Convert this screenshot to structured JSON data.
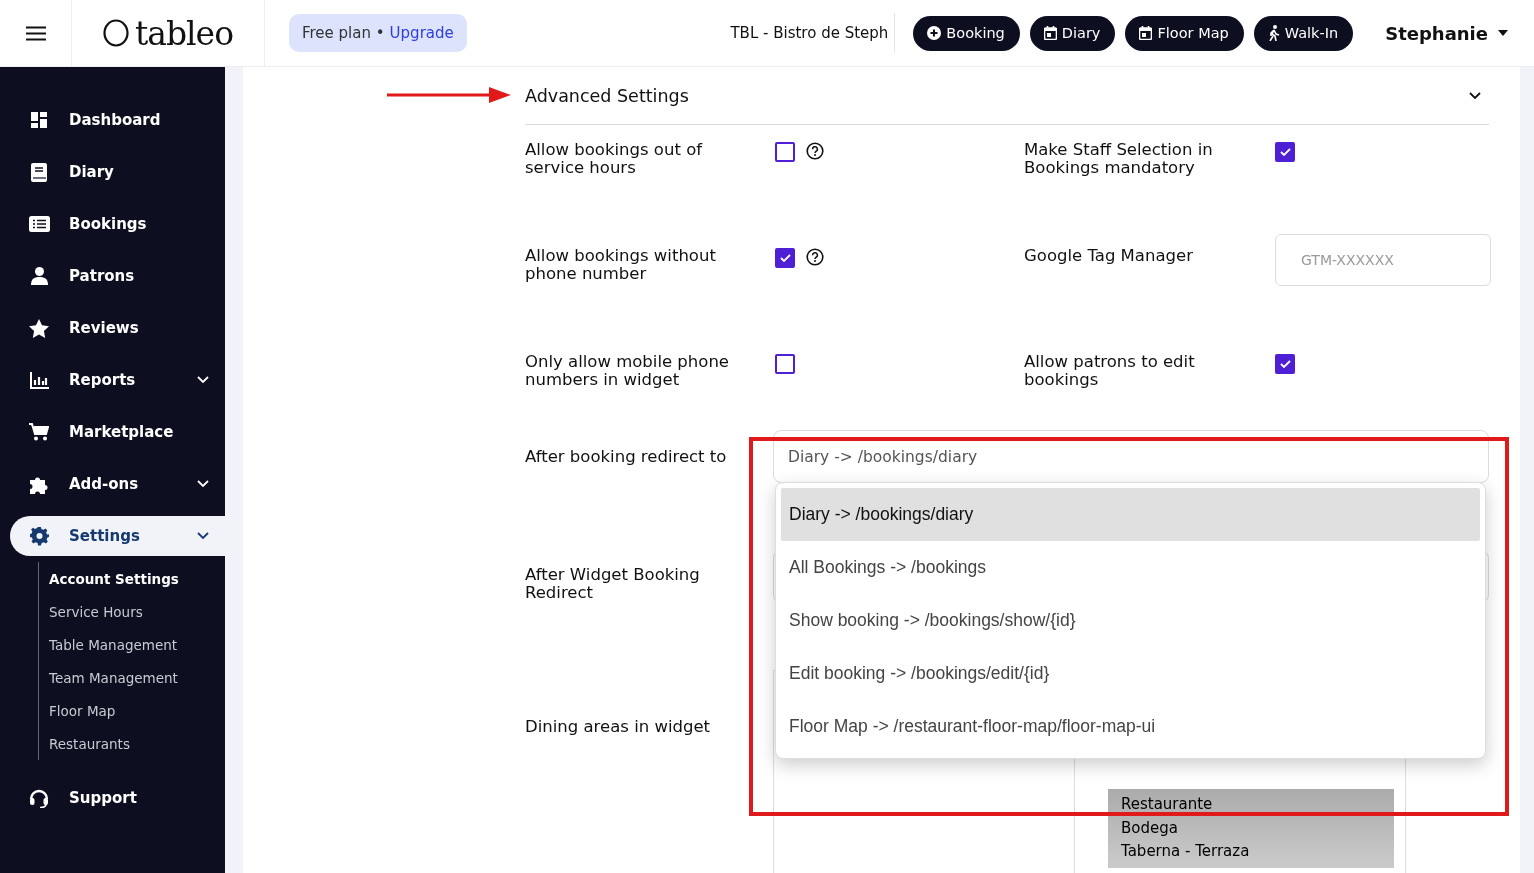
{
  "header": {
    "logo": "tableo",
    "plan": {
      "text": "Free plan •",
      "link": "Upgrade"
    },
    "restaurant": "TBL - Bistro de Steph",
    "actions": [
      {
        "kind": "plus",
        "label": "Booking"
      },
      {
        "kind": "calendar",
        "label": "Diary"
      },
      {
        "kind": "calendar",
        "label": "Floor Map"
      },
      {
        "kind": "walk",
        "label": "Walk-In"
      }
    ],
    "user": "Stephanie"
  },
  "sidebar": {
    "items": [
      {
        "kind": "dashboard",
        "label": "Dashboard",
        "selected": false,
        "expandable": false
      },
      {
        "kind": "book",
        "label": "Diary",
        "selected": false,
        "expandable": false
      },
      {
        "kind": "list",
        "label": "Bookings",
        "selected": false,
        "expandable": false
      },
      {
        "kind": "person",
        "label": "Patrons",
        "selected": false,
        "expandable": false
      },
      {
        "kind": "star",
        "label": "Reviews",
        "selected": false,
        "expandable": false
      },
      {
        "kind": "chart",
        "label": "Reports",
        "selected": false,
        "expandable": true
      },
      {
        "kind": "cart",
        "label": "Marketplace",
        "selected": false,
        "expandable": false
      },
      {
        "kind": "puzzle",
        "label": "Add-ons",
        "selected": false,
        "expandable": true
      },
      {
        "kind": "gear",
        "label": "Settings",
        "selected": true,
        "expandable": true,
        "children": [
          {
            "label": "Account Settings",
            "selected": true
          },
          {
            "label": "Service Hours",
            "selected": false
          },
          {
            "label": "Table Management",
            "selected": false
          },
          {
            "label": "Team Management",
            "selected": false
          },
          {
            "label": "Floor Map",
            "selected": false
          },
          {
            "label": "Restaurants",
            "selected": false
          }
        ]
      },
      {
        "kind": "headset",
        "label": "Support",
        "selected": false,
        "expandable": false
      }
    ]
  },
  "section": {
    "title": "Advanced Settings",
    "expanded": true
  },
  "settings": [
    {
      "left": {
        "kind": "checkbox",
        "label": "Allow bookings out of service hours",
        "checked": false,
        "help": true
      },
      "right": {
        "kind": "checkbox",
        "label": "Make Staff Selection in Bookings mandatory",
        "checked": true,
        "help": false
      }
    },
    {
      "left": {
        "kind": "checkbox",
        "label": "Allow bookings without phone number",
        "checked": true,
        "help": true
      },
      "right": {
        "kind": "text",
        "label": "Google Tag Manager",
        "placeholder": "GTM-XXXXXX"
      }
    },
    {
      "left": {
        "kind": "checkbox",
        "label": "Only allow mobile phone numbers in widget",
        "checked": false,
        "help": false
      },
      "right": {
        "kind": "checkbox",
        "label": "Allow patrons to edit bookings",
        "checked": true,
        "help": false
      }
    }
  ],
  "redirect": {
    "label": "After booking redirect to",
    "value": "Diary -> /bookings/diary",
    "open": true,
    "options": [
      {
        "label": "Diary -> /bookings/diary",
        "selected": true
      },
      {
        "label": "All Bookings -> /bookings",
        "selected": false
      },
      {
        "label": "Show booking -> /bookings/show/{id}",
        "selected": false
      },
      {
        "label": "Edit booking -> /bookings/edit/{id}",
        "selected": false
      },
      {
        "label": "Floor Map -> /restaurant-floor-map/floor-map-ui",
        "selected": false
      }
    ]
  },
  "widget_redirect": {
    "label": "After Widget Booking Redirect"
  },
  "dining_areas": {
    "label": "Dining areas in widget",
    "options": [
      {
        "label": "Restaurante",
        "selected": true
      },
      {
        "label": "Bodega",
        "selected": true
      },
      {
        "label": "Taberna - Terraza",
        "selected": true
      }
    ]
  }
}
